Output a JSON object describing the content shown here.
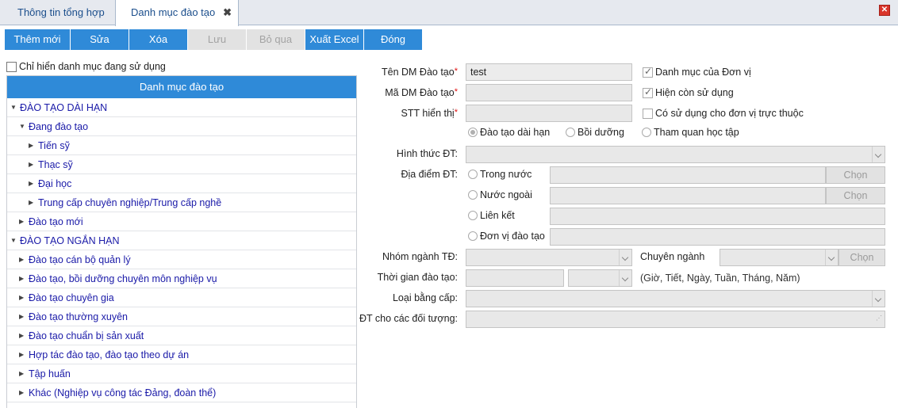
{
  "tabs": [
    {
      "label": "Thông tin tổng hợp"
    },
    {
      "label": "Danh mục đào tạo",
      "close": "✖"
    }
  ],
  "window_close": "✕",
  "toolbar": {
    "add": "Thêm mới",
    "edit": "Sửa",
    "delete": "Xóa",
    "save": "Lưu",
    "skip": "Bỏ qua",
    "export": "Xuất Excel",
    "close": "Đóng"
  },
  "filter": {
    "label": "Chỉ hiển danh mục đang sử dụng",
    "checked": false
  },
  "tree": {
    "header": "Danh mục đào tạo",
    "items": [
      {
        "label": "ĐÀO TẠO DÀI HẠN",
        "level": 0,
        "expanded": true
      },
      {
        "label": "Đang đào tạo",
        "level": 1,
        "expanded": true
      },
      {
        "label": "Tiến sỹ",
        "level": 2,
        "expanded": false
      },
      {
        "label": "Thạc sỹ",
        "level": 2,
        "expanded": false
      },
      {
        "label": "Đại học",
        "level": 2,
        "expanded": false
      },
      {
        "label": "Trung cấp chuyên nghiệp/Trung cấp nghề",
        "level": 2,
        "expanded": false
      },
      {
        "label": "Đào tạo mới",
        "level": 1,
        "expanded": false
      },
      {
        "label": "ĐÀO TẠO NGẮN HẠN",
        "level": 0,
        "expanded": true
      },
      {
        "label": "Đào tạo cán bộ quản lý",
        "level": 1,
        "expanded": false
      },
      {
        "label": "Đào tạo, bồi dưỡng chuyên môn nghiệp vụ",
        "level": 1,
        "expanded": false
      },
      {
        "label": "Đào tạo chuyên gia",
        "level": 1,
        "expanded": false
      },
      {
        "label": "Đào tạo thường xuyên",
        "level": 1,
        "expanded": false
      },
      {
        "label": "Đào tạo chuẩn bị sản xuất",
        "level": 1,
        "expanded": false
      },
      {
        "label": "Hợp tác đào tạo, đào tạo theo dự án",
        "level": 1,
        "expanded": false
      },
      {
        "label": "Tập huấn",
        "level": 1,
        "expanded": false
      },
      {
        "label": "Khác (Nghiệp vụ công tác Đảng, đoàn thể)",
        "level": 1,
        "expanded": false
      }
    ]
  },
  "form": {
    "ten_label": "Tên DM Đào tạo",
    "ten_value": "test",
    "ma_label": "Mã DM Đào tạo",
    "ma_value": "",
    "stt_label": "STT hiển thị",
    "stt_value": "",
    "required_mark": "*",
    "cb_donvi": "Danh mục của Đơn vị",
    "cb_hienconsudung": "Hiện còn sử dụng",
    "cb_trucThuoc": "Có sử dụng cho đơn vị trực thuộc",
    "radio_dai_han": "Đào tạo dài hạn",
    "radio_boi_duong": "Bồi dưỡng",
    "radio_tham_quan": "Tham quan học tập",
    "hinh_thuc_label": "Hình thức ĐT:",
    "dia_diem_label": "Địa điểm ĐT:",
    "dd_trong_nuoc": "Trong nước",
    "dd_nuoc_ngoai": "Nước ngoài",
    "dd_lien_ket": "Liên kết",
    "dd_don_vi": "Đơn vị đào tạo",
    "chon": "Chọn",
    "nhom_nganh_label": "Nhóm ngành TĐ:",
    "chuyen_nganh_label": "Chuyên ngành",
    "thoi_gian_label": "Thời gian đào tạo:",
    "thoi_gian_hint": "(Giờ, Tiết, Ngày, Tuần, Tháng, Năm)",
    "loai_bang_label": "Loại bằng cấp:",
    "doi_tuong_label": "ĐT cho các đối tượng:"
  },
  "colors": {
    "accent": "#2f8ad8",
    "link": "#1a1aa8",
    "required": "#e01010"
  },
  "icons": [
    "close-tab-icon",
    "window-close-icon",
    "caret-down-icon",
    "caret-right-icon",
    "dropdown-chevron-icon",
    "resize-grip-icon"
  ]
}
